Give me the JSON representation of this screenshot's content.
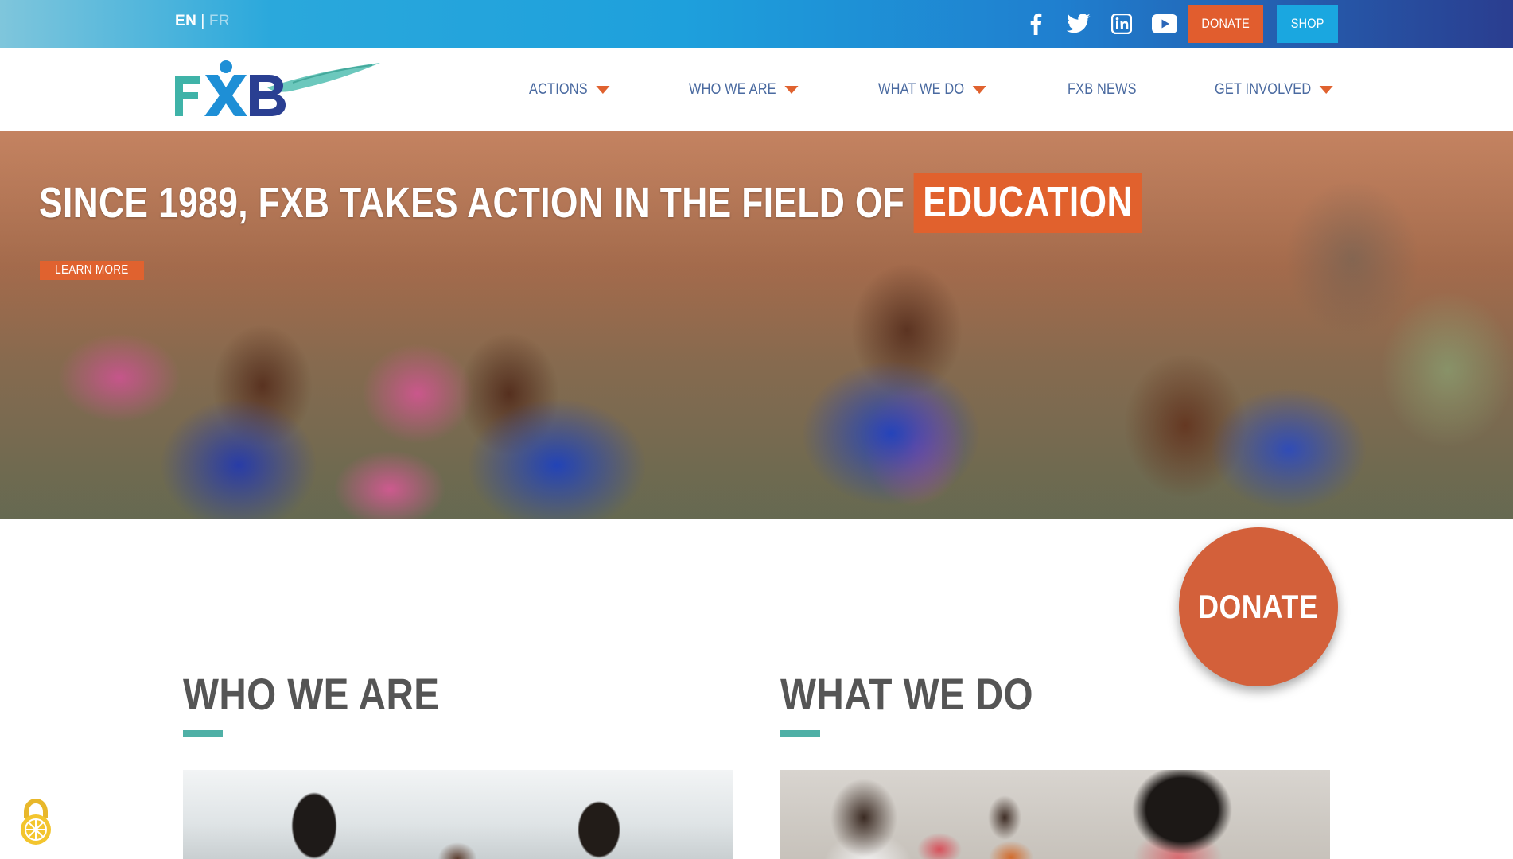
{
  "topbar": {
    "lang_active": "EN",
    "lang_separator": "|",
    "lang_other": "FR",
    "socials": [
      "facebook-icon",
      "twitter-icon",
      "linkedin-icon",
      "youtube-icon"
    ],
    "donate_label": "DONATE",
    "shop_label": "SHOP"
  },
  "header": {
    "logo_text": "FXB",
    "nav": [
      {
        "label": "ACTIONS",
        "has_dropdown": true
      },
      {
        "label": "WHO WE ARE",
        "has_dropdown": true
      },
      {
        "label": "WHAT WE DO",
        "has_dropdown": true
      },
      {
        "label": "FXB NEWS",
        "has_dropdown": false
      },
      {
        "label": "GET INVOLVED",
        "has_dropdown": true
      }
    ]
  },
  "hero": {
    "title": "SINCE 1989, FXB TAKES ACTION IN THE FIELD OF",
    "highlight": "EDUCATION",
    "cta": "LEARN MORE"
  },
  "donate_circle": {
    "label": "DONATE"
  },
  "sections": [
    {
      "heading": "WHO WE ARE"
    },
    {
      "heading": "WHAT WE DO"
    }
  ],
  "colors": {
    "accent_orange": "#e0622f",
    "accent_blue": "#1aa7e0",
    "nav_text": "#4a6aa0",
    "underline_teal": "#4fb0a6",
    "heading_gray": "#555555"
  }
}
